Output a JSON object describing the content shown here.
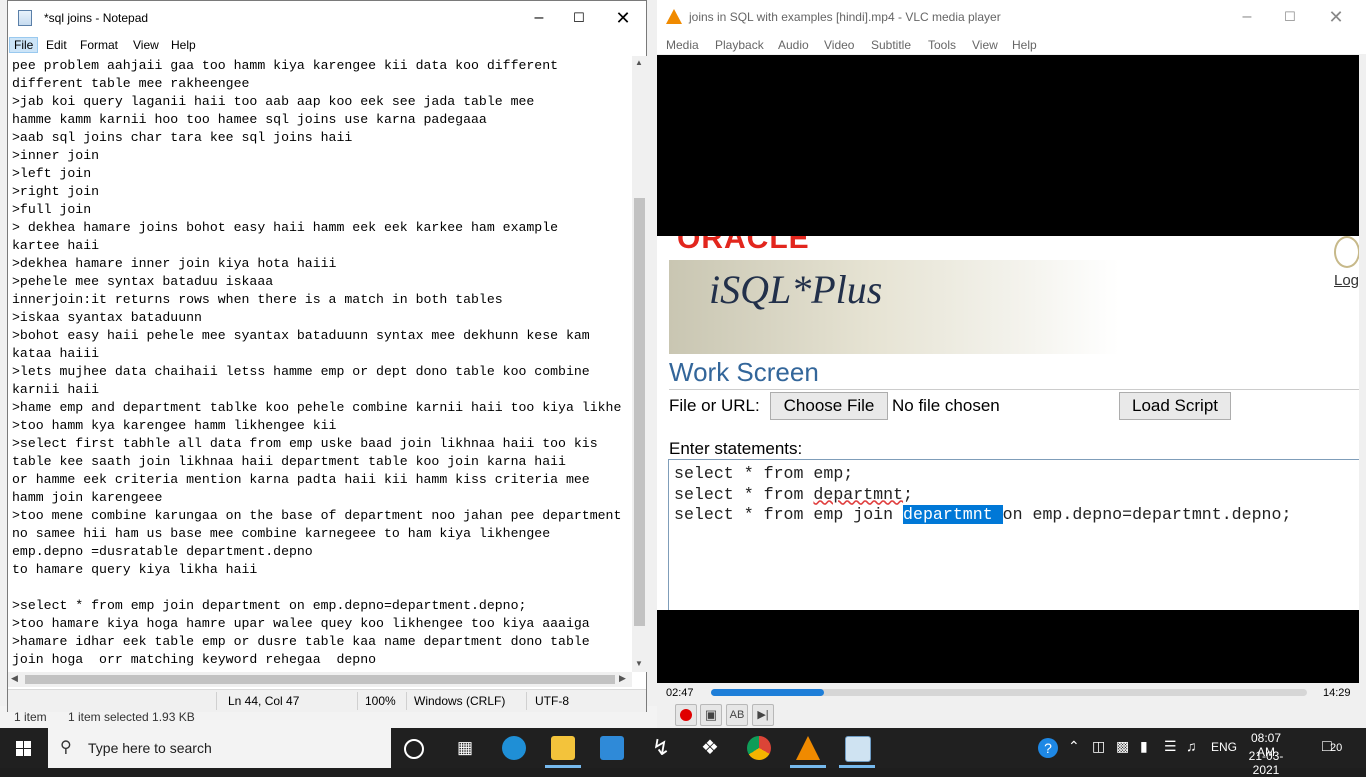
{
  "notepad": {
    "title": "*sql joins - Notepad",
    "menu": [
      "File",
      "Edit",
      "Format",
      "View",
      "Help"
    ],
    "lines": [
      "pee problem aahjaii gaa too hamm kiya karengee kii data koo different",
      "different table mee rakheengee",
      ">jab koi query laganii haii too aab aap koo eek see jada table mee",
      "hamme kamm karnii hoo too hamee sql joins use karna padegaaa",
      ">aab sql joins char tara kee sql joins haii",
      ">inner join",
      ">left join",
      ">right join",
      ">full join",
      "> dekhea hamare joins bohot easy haii hamm eek eek karkee ham example",
      "kartee haii",
      ">dekhea hamare inner join kiya hota haiii",
      ">pehele mee syntax bataduu iskaaa",
      "innerjoin:it returns rows when there is a match in both tables",
      ">iskaa syantax bataduunn",
      ">bohot easy haii pehele mee syantax bataduunn syntax mee dekhunn kese kam",
      "kataa haiii",
      ">lets mujhee data chaihaii letss hamme emp or dept dono table koo combine",
      "karnii haii",
      ">hame emp and department tablke koo pehele combine karnii haii too kiya likhe",
      ">too hamm kya karengee hamm likhengee kii",
      ">select first tabhle all data from emp uske baad join likhnaa haii too kis",
      "table kee saath join likhnaa haii department table koo join karna haii",
      "or hamme eek criteria mention karna padta haii kii hamm kiss criteria mee",
      "hamm join karengeee",
      ">too mene combine karungaa on the base of department noo jahan pee department",
      "no samee hii ham us base mee combine karnegeee to ham kiya likhengee",
      "emp.depno =dusratable department.depno",
      "to hamare query kiya likha haii",
      "",
      ">select * from emp join department on emp.depno=department.depno;",
      ">too hamare kiya hoga hamre upar walee quey koo likhengee too kiya aaaiga",
      ">hamare idhar eek table emp or dusre table kaa name department dono table",
      "join hoga  orr matching keyword rehegaa  depno"
    ],
    "status": {
      "position": "Ln 44, Col 47",
      "zoom": "100%",
      "line_ending": "Windows (CRLF)",
      "encoding": "UTF-8"
    }
  },
  "explorer": {
    "items_count": "1 item",
    "selection": "1 item selected  1.93 KB"
  },
  "vlc": {
    "title": "joins in SQL with examples [hindi].mp4 - VLC media player",
    "menu": [
      "Media",
      "Playback",
      "Audio",
      "Video",
      "Subtitle",
      "Tools",
      "View",
      "Help"
    ],
    "elapsed": "02:47",
    "total": "14:29",
    "progress": 0.19
  },
  "isql": {
    "brand": "ORACLE",
    "logo": "iSQL*Plus",
    "logout_link": "Log",
    "heading": "Work Screen",
    "file_label": "File or URL:",
    "choose_file": "Choose File",
    "no_file": "No file chosen",
    "load_script": "Load Script",
    "enter_label": "Enter statements:",
    "statements": [
      "select * from emp;",
      "select * from departmnt;",
      "select * from emp join departmnt on emp.depno=departmnt.depno;"
    ]
  },
  "taskbar": {
    "search_placeholder": "Type here to search",
    "language": "ENG",
    "time": "08:07 AM",
    "date": "21-03-2021",
    "notifications": "20"
  }
}
